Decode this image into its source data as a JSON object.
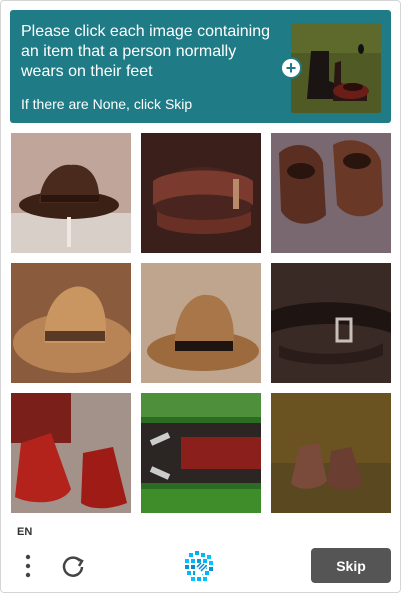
{
  "prompt": {
    "instruction": "Please click each image containing an item that a person normally wears on their feet",
    "sub": "If there are None, click Skip",
    "example_icon": "boots-example-image",
    "plus_icon": "plus-icon"
  },
  "tiles": [
    {
      "label": "hat",
      "row": 1,
      "col": 1
    },
    {
      "label": "belt",
      "row": 1,
      "col": 2
    },
    {
      "label": "shoes",
      "row": 1,
      "col": 3
    },
    {
      "label": "hat",
      "row": 2,
      "col": 1
    },
    {
      "label": "hat",
      "row": 2,
      "col": 2
    },
    {
      "label": "belt",
      "row": 2,
      "col": 3
    },
    {
      "label": "boots",
      "row": 3,
      "col": 1
    },
    {
      "label": "belt",
      "row": 3,
      "col": 2
    },
    {
      "label": "shoes",
      "row": 3,
      "col": 3
    }
  ],
  "footer": {
    "language": "EN",
    "menu_icon": "more-vertical-icon",
    "refresh_icon": "refresh-icon",
    "logo_icon": "hcaptcha-logo-icon",
    "skip_label": "Skip"
  },
  "colors": {
    "prompt_bg": "#1f7b85",
    "skip_bg": "#555555"
  }
}
